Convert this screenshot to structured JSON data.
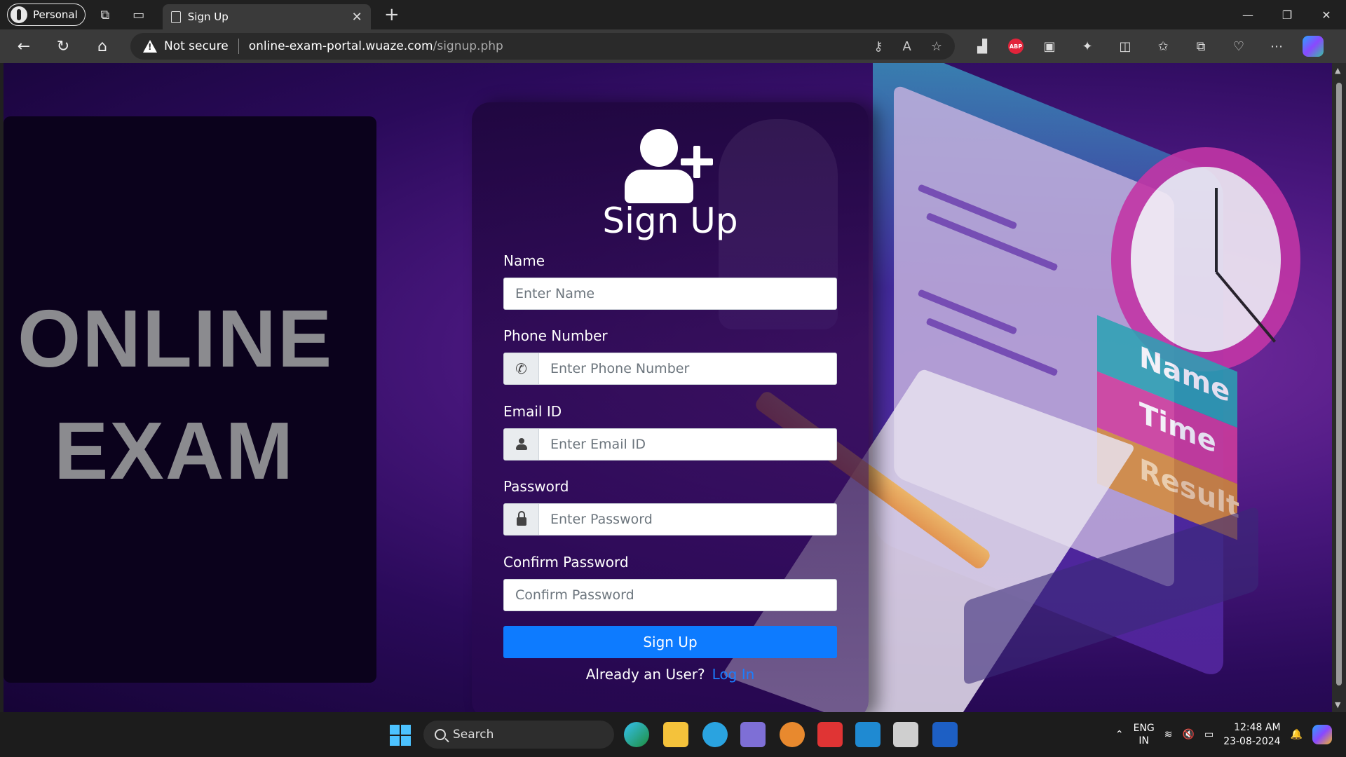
{
  "browser": {
    "profile_label": "Personal",
    "tab_title": "Sign Up",
    "security_label": "Not secure",
    "url_host": "online-exam-portal.wuaze.com",
    "url_path": "/signup.php",
    "abp_label": "ABP"
  },
  "page": {
    "brand_line1": "ONLINE",
    "brand_line2": "EXAM",
    "form_title": "Sign Up",
    "fields": {
      "name_label": "Name",
      "name_placeholder": "Enter Name",
      "phone_label": "Phone Number",
      "phone_placeholder": "Enter Phone Number",
      "email_label": "Email ID",
      "email_placeholder": "Enter Email ID",
      "password_label": "Password",
      "password_placeholder": "Enter Password",
      "confirm_label": "Confirm Password",
      "confirm_placeholder": "Confirm Password"
    },
    "submit_label": "Sign Up",
    "already_text": "Already an User?",
    "login_link": "Log In",
    "illustration_tags": [
      "Name",
      "Time",
      "Result"
    ]
  },
  "taskbar": {
    "search_label": "Search",
    "lang_line1": "ENG",
    "lang_line2": "IN",
    "time": "12:48 AM",
    "date": "23-08-2024"
  },
  "colors": {
    "accent": "#0d7bff",
    "link": "#1a7eff",
    "brand_text": "#8b8b8f"
  }
}
